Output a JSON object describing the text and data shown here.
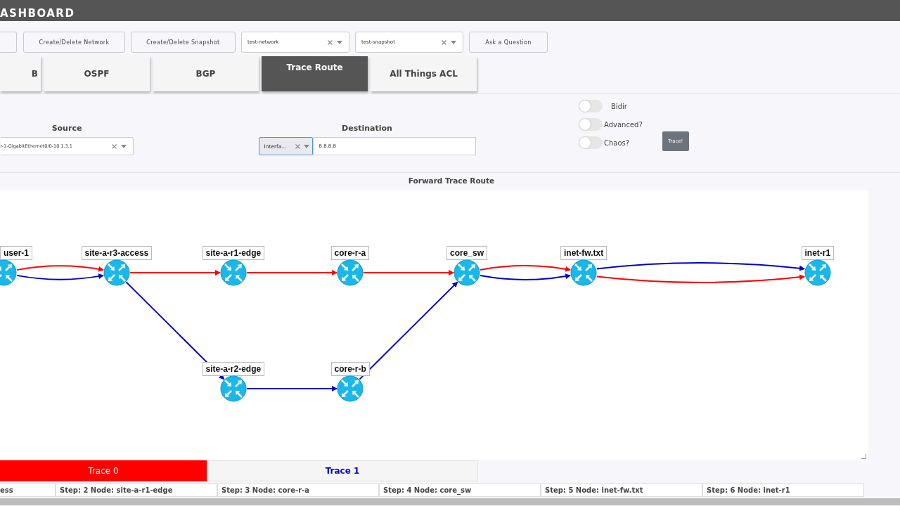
{
  "header": {
    "title": "ASHBOARD"
  },
  "toolbar": {
    "buttons": [
      {
        "kind": "button"
      },
      {
        "label": "Create/Delete Network",
        "kind": "button"
      },
      {
        "label": "Create/Delete Snapshot",
        "kind": "button"
      },
      {
        "label": "test-network",
        "kind": "select"
      },
      {
        "label": "test-snapshot",
        "kind": "select"
      },
      {
        "label": "Ask a Question",
        "kind": "button"
      }
    ]
  },
  "tabs": [
    {
      "label": "B",
      "selected": false
    },
    {
      "label": "OSPF",
      "selected": false
    },
    {
      "label": "BGP",
      "selected": false
    },
    {
      "label": "Trace Route",
      "selected": true
    },
    {
      "label": "All Things ACL",
      "selected": false
    }
  ],
  "source": {
    "label": "Source",
    "value": "r-1-GigabitEthernet0/0-10.1.3.1"
  },
  "destination": {
    "label": "Destination",
    "type": "Interfa...",
    "value": "8.8.8.8"
  },
  "toggles": [
    {
      "label": "Bidir",
      "on": false
    },
    {
      "label": "Advanced?",
      "on": false
    },
    {
      "label": "Chaos?",
      "on": false
    }
  ],
  "trace_button": "Trace!",
  "graph": {
    "title": "Forward Trace Route",
    "nodes": [
      {
        "name": "user-1"
      },
      {
        "name": "site-a-r3-access"
      },
      {
        "name": "site-a-r1-edge"
      },
      {
        "name": "core-r-a"
      },
      {
        "name": "core_sw"
      },
      {
        "name": "inet-fw.txt"
      },
      {
        "name": "inet-r1"
      },
      {
        "name": "site-a-r2-edge"
      },
      {
        "name": "core-r-b"
      }
    ]
  },
  "traces": [
    {
      "label": "Trace 0",
      "color": "#ff0000",
      "selected": true
    },
    {
      "label": "Trace 1",
      "color": "#0000cc",
      "selected": false
    }
  ],
  "steps": [
    "ess",
    "Step: 2 Node: site-a-r1-edge",
    "Step: 3 Node: core-r-a",
    "Step: 4 Node: core_sw",
    "Step: 5 Node: inet-fw.txt",
    "Step: 6 Node: inet-r1"
  ]
}
